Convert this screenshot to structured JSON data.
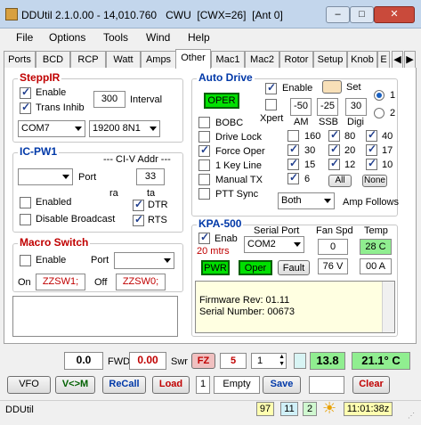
{
  "window": {
    "title": "DDUtil 2.1.0.00 - 14,010.760   CWU  [CWX=26]  [Ant 0]",
    "minimize": "–",
    "maximize": "□",
    "close": "✕"
  },
  "menu": [
    "File",
    "Options",
    "Tools",
    "Wind",
    "Help"
  ],
  "tabs": [
    "Ports",
    "BCD",
    "RCP",
    "Watt",
    "Amps",
    "Other",
    "Mac1",
    "Mac2",
    "Rotor",
    "Setup",
    "Knob",
    "E"
  ],
  "active_tab": "Other",
  "steppir": {
    "title": "SteppIR",
    "enable": "Enable",
    "trans_inhib": "Trans Inhib",
    "interval_value": "300",
    "interval_label": "Interval",
    "port": "COM7",
    "baud": "19200 8N1"
  },
  "icpw1": {
    "title": "IC-PW1",
    "civ_label": "--- CI-V Addr ---",
    "port_label": "Port",
    "civ_value": "33",
    "ra": "ra",
    "ta": "ta",
    "enabled": "Enabled",
    "disable_broadcast": "Disable Broadcast",
    "dtr": "DTR",
    "rts": "RTS"
  },
  "macro": {
    "title": "Macro Switch",
    "enable": "Enable",
    "port_label": "Port",
    "on_label": "On",
    "on_value": "ZZSW1;",
    "off_label": "Off",
    "off_value": "ZZSW0;"
  },
  "autodrive": {
    "title": "Auto Drive",
    "oper": "OPER",
    "enable": "Enable",
    "set": "Set",
    "xpert": "Xpert",
    "am_value": "-50",
    "am": "AM",
    "ssb_value": "-25",
    "ssb": "SSB",
    "digi_value": "30",
    "digi": "Digi",
    "radio1": "1",
    "radio2": "2",
    "options": [
      "BOBC",
      "Drive Lock",
      "Force Oper",
      "1 Key Line",
      "Manual TX",
      "PTT Sync"
    ],
    "bands": [
      "160",
      "80",
      "40",
      "30",
      "20",
      "17",
      "15",
      "12",
      "10",
      "6"
    ],
    "all": "All",
    "none": "None",
    "both": "Both",
    "amp_follows": "Amp Follows"
  },
  "kpa500": {
    "title": "KPA-500",
    "enab": "Enab",
    "band": "20 mtrs",
    "serial_label": "Serial Port",
    "port": "COM2",
    "fan_label": "Fan Spd",
    "fan_value": "0",
    "temp_label": "Temp",
    "temp_value": "28 C",
    "pwr": "PWR",
    "oper": "Oper",
    "fault": "Fault",
    "volts": "76 V",
    "amps": "00 A",
    "log": [
      "Firmware Rev: 01.11",
      "Serial Number: 00673"
    ]
  },
  "meters": {
    "fwd_value": "0.0",
    "fwd_label": "FWD",
    "pwr_value": "0.00",
    "swr_label": "Swr",
    "fz": "FZ",
    "num5": "5",
    "spin": "1",
    "v138": "13.8",
    "temp": "21.1° C"
  },
  "buttons": {
    "vfo": "VFO",
    "vm": "V<>M",
    "recall": "ReCall",
    "load": "Load",
    "slot": "1",
    "empty": "Empty",
    "save": "Save",
    "clear": "Clear"
  },
  "status": {
    "app": "DDUtil",
    "n97": "97",
    "n11": "11",
    "n2": "2",
    "time": "11:01:38z"
  },
  "colors": {
    "green": "#00e000",
    "red_text": "#c00000",
    "blue_text": "#0038a8"
  }
}
